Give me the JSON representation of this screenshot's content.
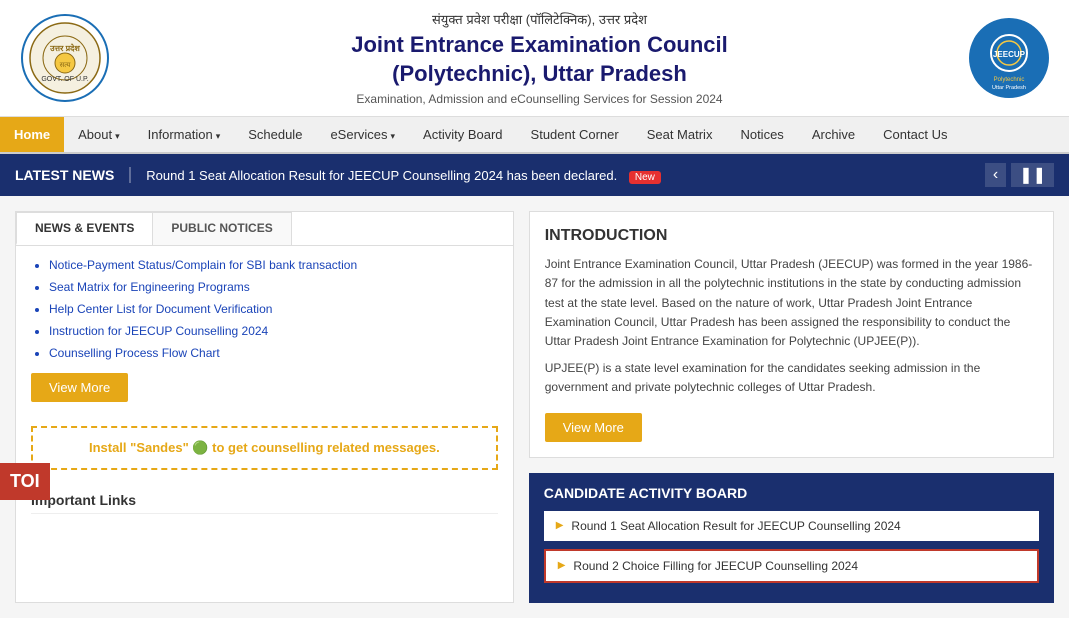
{
  "header": {
    "hindi_title": "संयुक्त प्रवेश परीक्षा (पॉलिटेक्निक), उत्तर प्रदेश",
    "main_title": "Joint Entrance Examination Council",
    "main_title_line2": "(Polytechnic), Uttar Pradesh",
    "subtitle": "Examination, Admission and eCounselling Services for Session 2024"
  },
  "nav": {
    "items": [
      {
        "label": "Home",
        "active": true,
        "dropdown": false
      },
      {
        "label": "About",
        "active": false,
        "dropdown": true
      },
      {
        "label": "Information",
        "active": false,
        "dropdown": true
      },
      {
        "label": "Schedule",
        "active": false,
        "dropdown": false
      },
      {
        "label": "eServices",
        "active": false,
        "dropdown": true
      },
      {
        "label": "Activity Board",
        "active": false,
        "dropdown": false
      },
      {
        "label": "Student Corner",
        "active": false,
        "dropdown": false
      },
      {
        "label": "Seat Matrix",
        "active": false,
        "dropdown": false
      },
      {
        "label": "Notices",
        "active": false,
        "dropdown": false
      },
      {
        "label": "Archive",
        "active": false,
        "dropdown": false
      },
      {
        "label": "Contact Us",
        "active": false,
        "dropdown": false
      }
    ]
  },
  "latest_news": {
    "label": "LATEST NEWS",
    "text": "Round 1 Seat Allocation Result for JEECUP Counselling 2024 has been declared.",
    "badge": "New"
  },
  "left_panel": {
    "tabs": [
      {
        "label": "NEWS & EVENTS",
        "active": true
      },
      {
        "label": "PUBLIC NOTICES",
        "active": false
      }
    ],
    "news_items": [
      "Notice-Payment Status/Complain for SBI bank transaction",
      "Seat Matrix for Engineering Programs",
      "Help Center List for Document Verification",
      "Instruction for JEECUP Counselling 2024",
      "Counselling Process Flow Chart"
    ],
    "view_more_label": "View More",
    "sandes_text_prefix": "Install ",
    "sandes_brand": "\"Sandes\"",
    "sandes_text_suffix": " to get counselling related messages.",
    "important_links_title": "Important Links"
  },
  "right_panel": {
    "intro": {
      "title": "INTRODUCTION",
      "text1": "Joint Entrance Examination Council, Uttar Pradesh (JEECUP) was formed in the year 1986-87 for the admission in all the polytechnic institutions in the state by conducting admission test at the state level. Based on the nature of work, Uttar Pradesh Joint Entrance Examination Council, Uttar Pradesh has been assigned the responsibility to conduct the Uttar Pradesh Joint Entrance Examination for Polytechnic (UPJEE(P)).",
      "text2": "UPJEE(P) is a state level examination for the candidates seeking admission in the government and private polytechnic colleges of Uttar Pradesh.",
      "view_more_label": "View More"
    },
    "activity_board": {
      "title": "CANDIDATE ACTIVITY BOARD",
      "items": [
        {
          "label": "Round 1 Seat Allocation Result for JEECUP Counselling 2024",
          "highlighted": false
        },
        {
          "label": "Round 2 Choice Filling for JEECUP Counselling 2024",
          "highlighted": true
        }
      ]
    }
  },
  "toi_badge": "TOI"
}
